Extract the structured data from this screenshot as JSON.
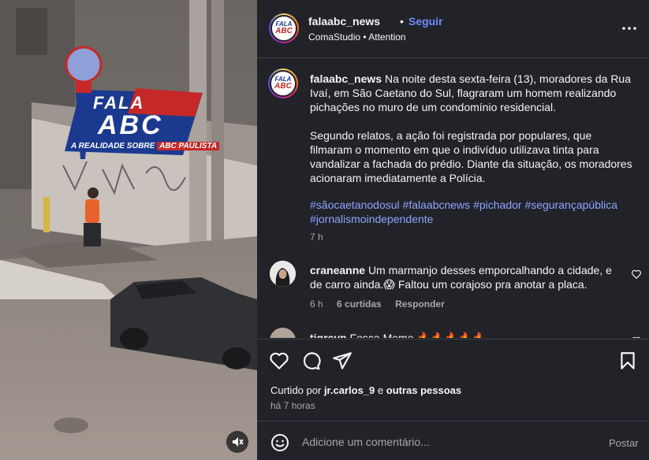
{
  "post": {
    "username": "falaabc_news",
    "dot": "•",
    "follow_label": "Seguir",
    "audio": "ComaStudio • Attention",
    "avatar_logo_top": "FALA",
    "avatar_logo_bottom": "ABC",
    "more_icon": "more-horizontal-icon"
  },
  "media": {
    "logo_fala": "FALA",
    "logo_abc": "ABC",
    "logo_tagline": "A REALIDADE SOBRE",
    "logo_tagline_highlight": "ABC PAULISTA",
    "mute_icon": "speaker-muted-icon"
  },
  "caption": {
    "username": "falaabc_news",
    "paragraph1": "Na noite desta sexta-feira (13), moradores da Rua Ivaí, em São Caetano do Sul, flagraram um homem realizando pichações no muro de um condomínio residencial.",
    "paragraph2": "Segundo relatos, a ação foi registrada por populares, que filmaram o momento em que o indivíduo utilizava tinta para vandalizar a fachada do prédio. Diante da situação, os moradores acionaram imediatamente a Polícia.",
    "hashtags": [
      "#sãocaetanodosul",
      "#falaabcnews",
      "#pichador",
      "#segurançapública",
      "#jornalismoindependente"
    ],
    "time": "7 h"
  },
  "comments": [
    {
      "username": "craneanne",
      "text": "Um marmanjo desses emporcalhando a cidade, e de carro ainda.😱 Faltou um corajoso pra anotar a placa.",
      "time": "6 h",
      "likes": "6 curtidas",
      "reply": "Responder"
    },
    {
      "username": "tigreyp",
      "text": "Fosca Memo 🔥🔥🔥🔥🔥"
    }
  ],
  "actions": {
    "icons": [
      "heart-icon",
      "comment-icon",
      "share-icon",
      "bookmark-icon"
    ],
    "liked_prefix": "Curtido por",
    "liked_user": "jr.carlos_9",
    "liked_and": "e",
    "liked_others": "outras pessoas",
    "ago": "há 7 horas"
  },
  "add_comment": {
    "placeholder": "Adicione um comentário...",
    "post_label": "Postar",
    "emoji_icon": "emoji-smile-icon"
  }
}
